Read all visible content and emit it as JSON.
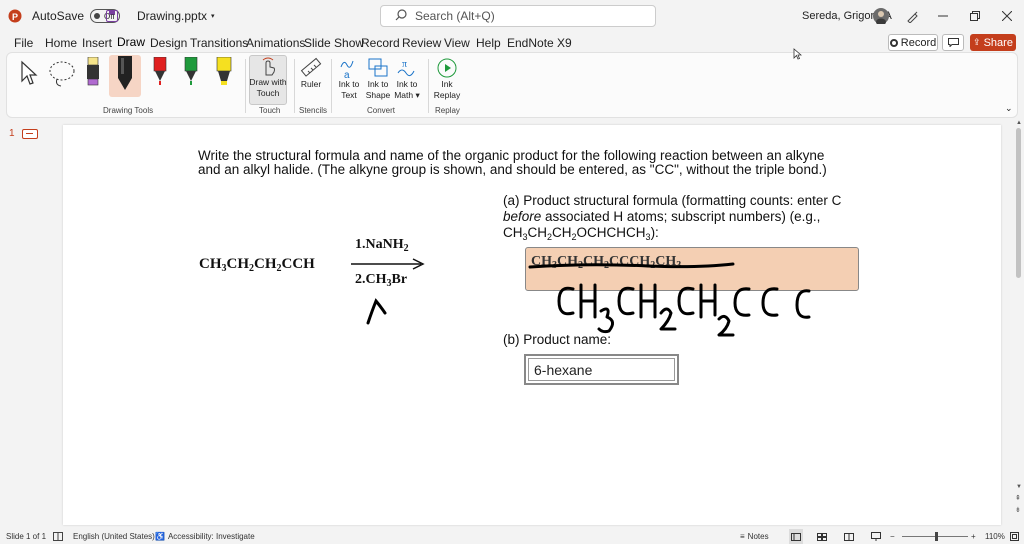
{
  "titlebar": {
    "autosave_label": "AutoSave",
    "autosave_state": "Off",
    "filename": "Drawing.pptx",
    "search_placeholder": "Search (Alt+Q)",
    "user_name": "Sereda, Grigoriy A"
  },
  "menu": {
    "tabs": [
      "File",
      "Home",
      "Insert",
      "Draw",
      "Design",
      "Transitions",
      "Animations",
      "Slide Show",
      "Record",
      "Review",
      "View",
      "Help",
      "EndNote X9"
    ],
    "active": "Draw",
    "record_label": "Record",
    "share_label": "Share"
  },
  "ribbon": {
    "groups": {
      "drawing_tools": "Drawing Tools",
      "touch": "Touch",
      "stencils": "Stencils",
      "convert": "Convert",
      "replay": "Replay"
    },
    "buttons": {
      "draw_with_touch": [
        "Draw with",
        "Touch"
      ],
      "ruler": "Ruler",
      "ink_to_text": [
        "Ink to",
        "Text"
      ],
      "ink_to_shape": [
        "Ink to",
        "Shape"
      ],
      "ink_to_math": [
        "Ink to",
        "Math"
      ],
      "ink_replay": [
        "Ink",
        "Replay"
      ]
    },
    "pen_colors": [
      "#222222",
      "#222222",
      "#e02020",
      "#1f9a3c",
      "#f5e020"
    ]
  },
  "slides_pane": {
    "slide_number": "1"
  },
  "slide": {
    "question_line1": "Write the structural formula and name of the organic product for the following reaction between an alkyne",
    "question_line2": "and an alkyl halide. (The alkyne group is shown, and should be entered, as \"CC\", without the triple bond.)",
    "reactant": "CH3CH2CH2CCH",
    "reagent1": "1.NaNH2",
    "reagent2": "2.CH3Br",
    "part_a_line1": "(a) Product structural formula (formatting counts: enter C",
    "part_a_line2_italic": "before",
    "part_a_line2_rest": " associated H atoms; subscript numbers) (e.g.,",
    "part_a_line3": "CH3CH2CH2OCHCHCH3):",
    "part_a_answer_struck": "CH3CH2CH2CCCH2CH3",
    "handwritten_answer": "CH3CH2CH2CC",
    "part_b_label": "(b) Product name:",
    "part_b_answer": "6-hexane"
  },
  "status": {
    "slide_info": "Slide 1 of 1",
    "language": "English (United States)",
    "accessibility": "Accessibility: Investigate",
    "notes": "Notes",
    "zoom": "110%"
  }
}
